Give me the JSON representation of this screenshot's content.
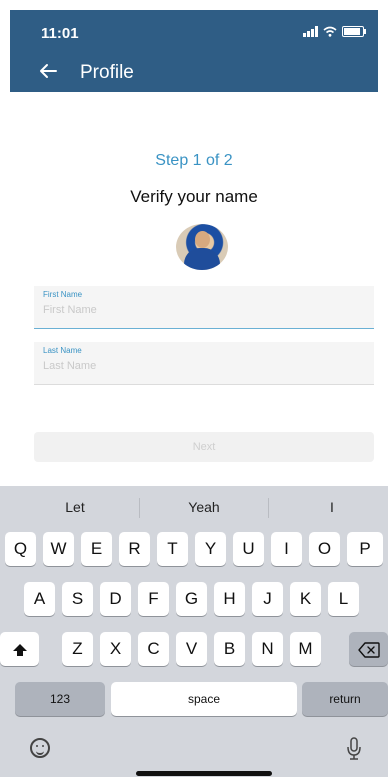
{
  "status_bar": {
    "time": "11:01",
    "signal_icon": "signal-icon",
    "wifi_icon": "wifi-icon",
    "battery_icon": "battery-icon"
  },
  "header": {
    "back_icon": "arrow-left-icon",
    "title": "Profile"
  },
  "form": {
    "step": "Step 1 of 2",
    "heading": "Verify your name",
    "first_name": {
      "label": "First Name",
      "placeholder": "First Name",
      "value": ""
    },
    "last_name": {
      "label": "Last Name",
      "placeholder": "Last Name",
      "value": ""
    },
    "next_label": "Next"
  },
  "keyboard": {
    "suggestions": [
      "Let",
      "Yeah",
      "I"
    ],
    "row1": [
      "Q",
      "W",
      "E",
      "R",
      "T",
      "Y",
      "U",
      "I",
      "O",
      "P"
    ],
    "row2": [
      "A",
      "S",
      "D",
      "F",
      "G",
      "H",
      "J",
      "K",
      "L"
    ],
    "row3": [
      "Z",
      "X",
      "C",
      "V",
      "B",
      "N",
      "M"
    ],
    "numbers_label": "123",
    "space_label": "space",
    "return_label": "return",
    "shift_icon": "shift-icon",
    "delete_icon": "delete-icon",
    "emoji_icon": "emoji-icon",
    "mic_icon": "microphone-icon"
  },
  "colors": {
    "header": "#2f5d85",
    "accent": "#3a93c4",
    "keyboard": "#d3d6dc"
  }
}
